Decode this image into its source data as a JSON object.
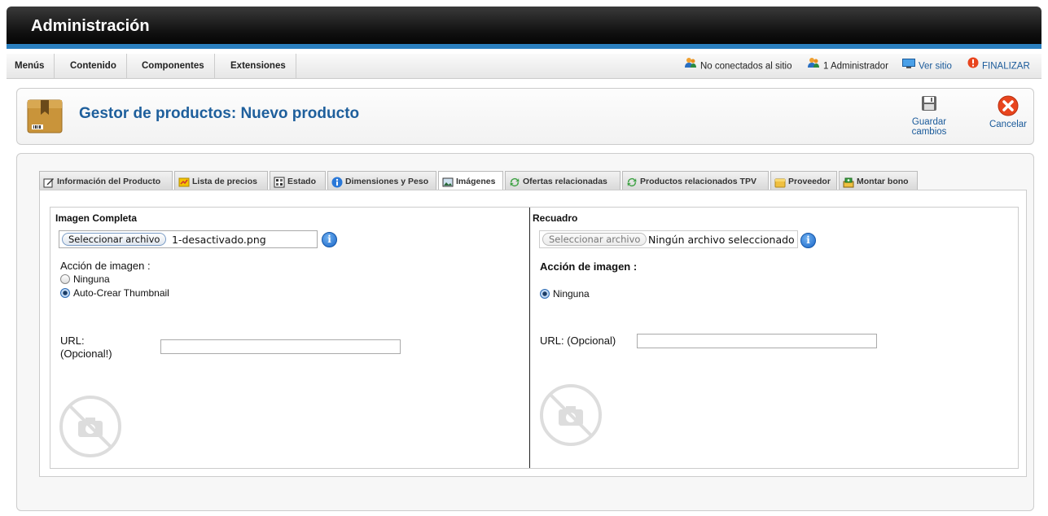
{
  "header": {
    "title": "Administración"
  },
  "menubar": {
    "items": [
      "Menús",
      "Contenido",
      "Componentes",
      "Extensiones"
    ],
    "status": {
      "offline": "No conectados al sitio",
      "admins": "1 Administrador",
      "view_site": "Ver sitio",
      "logout": "FINALIZAR"
    }
  },
  "toolbar": {
    "title": "Gestor de productos: Nuevo producto",
    "save_label": "Guardar cambios",
    "cancel_label": "Cancelar"
  },
  "tabs": [
    {
      "label": "Información del Producto",
      "icon": "edit-icon"
    },
    {
      "label": "Lista de precios",
      "icon": "price-list-icon"
    },
    {
      "label": "Estado",
      "icon": "status-icon"
    },
    {
      "label": "Dimensiones y Peso",
      "icon": "info-icon"
    },
    {
      "label": "Imágenes",
      "icon": "image-icon",
      "active": true
    },
    {
      "label": "Ofertas relacionadas",
      "icon": "refresh-icon"
    },
    {
      "label": "Productos relacionados TPV",
      "icon": "refresh-icon"
    },
    {
      "label": "Proveedor",
      "icon": "box-icon"
    },
    {
      "label": "Montar bono",
      "icon": "bundle-icon"
    }
  ],
  "full_image": {
    "heading": "Imagen Completa",
    "file_button": "Seleccionar archivo",
    "file_name": "1-desactivado.png",
    "action_label": "Acción de imagen :",
    "options": [
      "Ninguna",
      "Auto-Crear Thumbnail"
    ],
    "selected": "Auto-Crear Thumbnail",
    "url_label_1": "URL:",
    "url_label_2": "(Opcional!)",
    "url_value": ""
  },
  "thumbnail": {
    "heading": "Recuadro",
    "file_button": "Seleccionar archivo",
    "file_name": "Ningún archivo seleccionado",
    "action_label": "Acción de imagen :",
    "options": [
      "Ninguna"
    ],
    "selected": "Ninguna",
    "url_label": "URL: (Opcional)",
    "url_value": ""
  },
  "colors": {
    "accent_blue": "#2a7fbf",
    "title_blue": "#1e5f9c",
    "cancel_red": "#e8451e"
  }
}
